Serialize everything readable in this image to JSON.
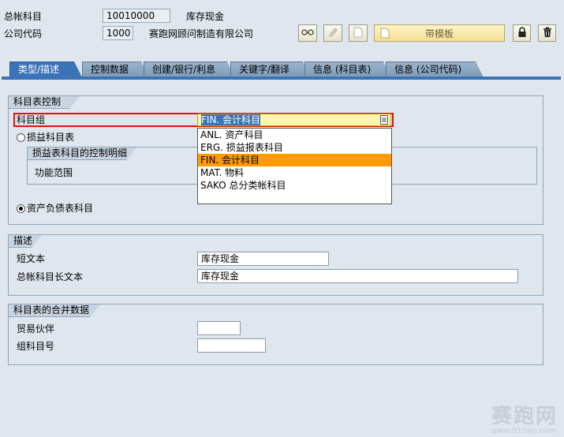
{
  "header": {
    "gl_account_label": "总帐科目",
    "gl_account_value": "10010000",
    "gl_account_desc": "库存现金",
    "company_code_label": "公司代码",
    "company_code_value": "1000",
    "company_name": "赛跑网顾问制造有限公司"
  },
  "toolbar": {
    "template_label": "带模板"
  },
  "tabs": [
    {
      "label": "类型/描述",
      "active": true
    },
    {
      "label": "控制数据"
    },
    {
      "label": "创建/银行/利息"
    },
    {
      "label": "关键字/翻译"
    },
    {
      "label": "信息 (科目表)"
    },
    {
      "label": "信息 (公司代码)"
    }
  ],
  "coa_control": {
    "title": "科目表控制",
    "account_group_label": "科目组",
    "account_group_value": "FIN. 会计科目",
    "pl_radio_label": "损益科目表",
    "pl_sub_title": "损益表科目的控制明细",
    "functional_area_label": "功能范围",
    "bs_radio_label": "资产负债表科目"
  },
  "dropdown": {
    "options": [
      {
        "label": "ANL.  资产科目"
      },
      {
        "label": "ERG.  损益报表科目"
      },
      {
        "label": "FIN.   会计科目",
        "selected": true
      },
      {
        "label": "MAT.  物料"
      },
      {
        "label": "SAKO 总分类帐科目"
      }
    ]
  },
  "description": {
    "title": "描述",
    "short_text_label": "短文本",
    "short_text_value": "库存现金",
    "long_text_label": "总帐科目长文本",
    "long_text_value": "库存现金"
  },
  "consolidation": {
    "title": "科目表的合并数据",
    "trading_partner_label": "贸易伙伴",
    "group_account_label": "组科目号"
  },
  "watermark": {
    "text": "赛跑网",
    "url": "www.915ap.com"
  },
  "colors": {
    "active_tab": "#3a73b8",
    "selected_option": "#ff9b00",
    "highlight_border": "#e01010"
  }
}
